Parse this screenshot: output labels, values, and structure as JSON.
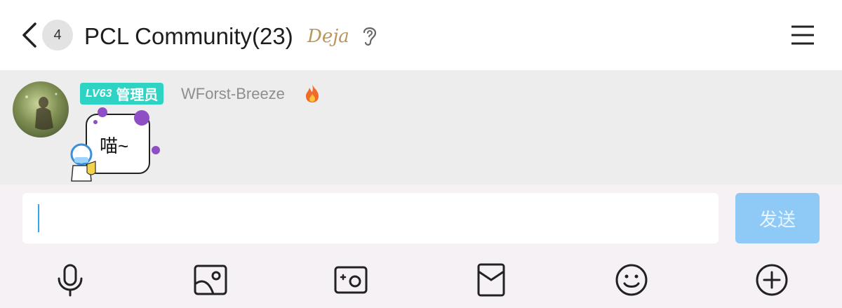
{
  "header": {
    "unread_count": "4",
    "title": "PCL Community(23)",
    "badge_logo_text": "Deja",
    "icons": [
      "back-icon",
      "ear-icon",
      "menu-icon"
    ]
  },
  "message": {
    "level_label": "LV63",
    "role_label": "管理员",
    "sender": "WForst-Breeze",
    "sender_badge_icon": "fire-icon",
    "sticker_text": "喵~"
  },
  "composer": {
    "input_value": "",
    "send_label": "发送",
    "send_color": "#8fcaf7"
  },
  "toolbar": [
    "microphone-icon",
    "image-icon",
    "camera-icon",
    "red-envelope-icon",
    "emoji-icon",
    "plus-icon"
  ],
  "colors": {
    "level_badge": "#2ed3c3",
    "accent_caret": "#2fa6ee",
    "message_bg": "#ededed",
    "composer_bg": "#f6f1f4"
  }
}
